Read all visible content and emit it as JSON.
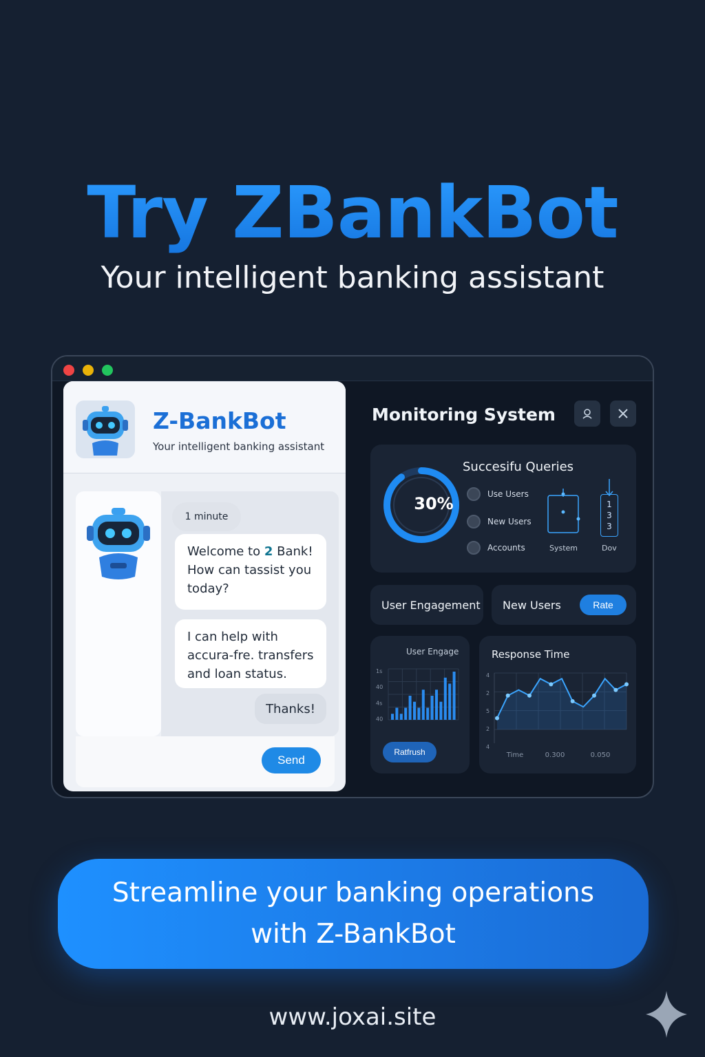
{
  "hero": {
    "title": "Try ZBankBot",
    "subtitle": "Your intelligent banking assistant"
  },
  "chat": {
    "title": "Z-BankBot",
    "subtitle": "Your intelligent banking assistant",
    "time_chip": "1 minute",
    "msg1_a": "Welcome to ",
    "msg1_highlight": "2",
    "msg1_b": " Bank! How can tassist you today?",
    "msg2": "I can help with accura-fre. transfers and loan status.",
    "reply": "Thanks!",
    "send_label": "Send"
  },
  "monitor": {
    "title": "Monitoring System",
    "queries_title": "Succesifu Queries",
    "ring_value": "30%",
    "ring_fraction": 0.3,
    "legend": [
      "Use Users",
      "New Users",
      "Accounts"
    ],
    "system_label": "System",
    "dov_label": "Dov",
    "num_box": [
      "1",
      "3",
      "3"
    ],
    "engagement_label": "User Engagement",
    "new_users_label": "New Users",
    "rate_label": "Rate",
    "eng_chart_title": "User Engage",
    "eng_y_ticks": [
      "1s",
      "40",
      "4s",
      "40"
    ],
    "refresh_label": "Ratfrush",
    "resp_title": "Response Time",
    "resp_y_ticks": [
      "4",
      "2",
      "5",
      "2",
      "4"
    ],
    "resp_x_ticks": [
      "Time",
      "0.300",
      "0.050"
    ]
  },
  "cta": {
    "text": "Streamline your banking operations with Z-BankBot"
  },
  "footer": {
    "url": "www.joxai.site"
  },
  "chart_data": [
    {
      "type": "bar",
      "title": "User Engage",
      "values": [
        1,
        2,
        1,
        2,
        4,
        3,
        2,
        5,
        2,
        4,
        5,
        3,
        7,
        6,
        8
      ]
    },
    {
      "type": "line",
      "title": "Response Time",
      "values": [
        2,
        6,
        7,
        6,
        9,
        8,
        9,
        5,
        4,
        6,
        9,
        7,
        8
      ]
    }
  ],
  "colors": {
    "background": "#152031",
    "accent": "#1f8bf2",
    "panel": "#1a2434"
  }
}
